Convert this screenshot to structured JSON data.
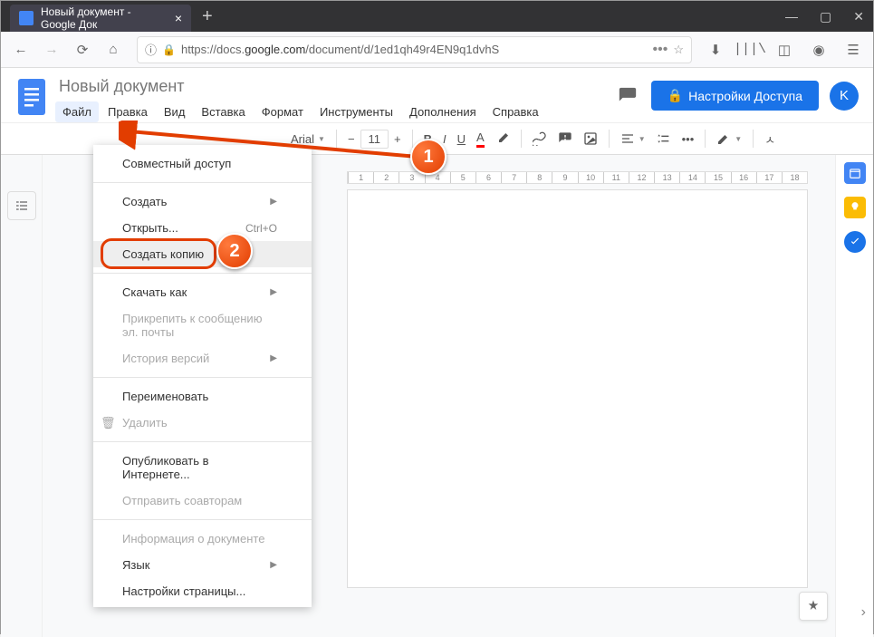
{
  "browser": {
    "tab_title": "Новый документ - Google Док",
    "url_display_pre": "https://docs.",
    "url_display_domain": "google.com",
    "url_display_post": "/document/d/1ed1qh49r4EN9q1dvhS"
  },
  "docs": {
    "title": "Новый документ",
    "share_label": "Настройки Доступа",
    "avatar_initial": "K",
    "menus": [
      "Файл",
      "Правка",
      "Вид",
      "Вставка",
      "Формат",
      "Инструменты",
      "Дополнения",
      "Справка"
    ]
  },
  "toolbar": {
    "font": "Arial",
    "size": "11",
    "bold": "B",
    "italic": "I",
    "underline": "U"
  },
  "ruler_ticks": [
    "2",
    "1",
    "",
    "1",
    "2",
    "3",
    "4",
    "5",
    "6",
    "7",
    "8",
    "9",
    "10",
    "11",
    "12",
    "13",
    "14",
    "15",
    "16",
    "17",
    "18"
  ],
  "file_menu": {
    "share": "Совместный доступ",
    "new": "Создать",
    "open": "Открыть...",
    "open_shortcut": "Ctrl+O",
    "make_copy": "Создать копию",
    "download": "Скачать как",
    "email_attach": "Прикрепить к сообщению эл. почты",
    "version_history": "История версий",
    "rename": "Переименовать",
    "delete": "Удалить",
    "publish": "Опубликовать в Интернете...",
    "email_collab": "Отправить соавторам",
    "doc_info": "Информация о документе",
    "language": "Язык",
    "page_setup": "Настройки страницы..."
  },
  "annotations": {
    "step1": "1",
    "step2": "2"
  }
}
